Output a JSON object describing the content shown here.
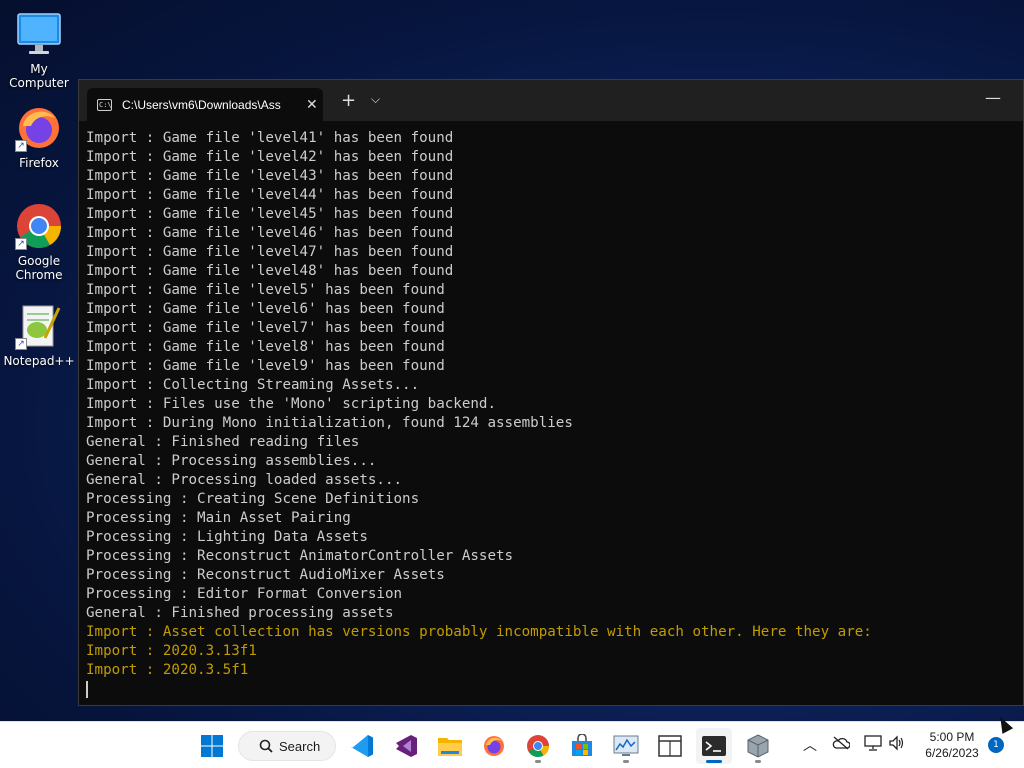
{
  "desktop": {
    "icons": [
      {
        "label": "My Computer",
        "icon": "monitor-icon"
      },
      {
        "label": "Firefox",
        "icon": "firefox-icon"
      },
      {
        "label": "Google Chrome",
        "icon": "chrome-icon"
      },
      {
        "label": "Notepad++",
        "icon": "notepadpp-icon"
      }
    ]
  },
  "terminal": {
    "tab_title": "C:\\Users\\vm6\\Downloads\\Ass",
    "close_glyph": "✕",
    "new_tab_glyph": "+",
    "dropdown_glyph": "⌵",
    "minimize_glyph": "—",
    "text_color": "#cccccc",
    "warn_color": "#c19c00",
    "lines": [
      {
        "text": "Import : Game file 'level41' has been found",
        "warn": false
      },
      {
        "text": "Import : Game file 'level42' has been found",
        "warn": false
      },
      {
        "text": "Import : Game file 'level43' has been found",
        "warn": false
      },
      {
        "text": "Import : Game file 'level44' has been found",
        "warn": false
      },
      {
        "text": "Import : Game file 'level45' has been found",
        "warn": false
      },
      {
        "text": "Import : Game file 'level46' has been found",
        "warn": false
      },
      {
        "text": "Import : Game file 'level47' has been found",
        "warn": false
      },
      {
        "text": "Import : Game file 'level48' has been found",
        "warn": false
      },
      {
        "text": "Import : Game file 'level5' has been found",
        "warn": false
      },
      {
        "text": "Import : Game file 'level6' has been found",
        "warn": false
      },
      {
        "text": "Import : Game file 'level7' has been found",
        "warn": false
      },
      {
        "text": "Import : Game file 'level8' has been found",
        "warn": false
      },
      {
        "text": "Import : Game file 'level9' has been found",
        "warn": false
      },
      {
        "text": "Import : Collecting Streaming Assets...",
        "warn": false
      },
      {
        "text": "Import : Files use the 'Mono' scripting backend.",
        "warn": false
      },
      {
        "text": "Import : During Mono initialization, found 124 assemblies",
        "warn": false
      },
      {
        "text": "General : Finished reading files",
        "warn": false
      },
      {
        "text": "General : Processing assemblies...",
        "warn": false
      },
      {
        "text": "General : Processing loaded assets...",
        "warn": false
      },
      {
        "text": "Processing : Creating Scene Definitions",
        "warn": false
      },
      {
        "text": "Processing : Main Asset Pairing",
        "warn": false
      },
      {
        "text": "Processing : Lighting Data Assets",
        "warn": false
      },
      {
        "text": "Processing : Reconstruct AnimatorController Assets",
        "warn": false
      },
      {
        "text": "Processing : Reconstruct AudioMixer Assets",
        "warn": false
      },
      {
        "text": "Processing : Editor Format Conversion",
        "warn": false
      },
      {
        "text": "General : Finished processing assets",
        "warn": false
      },
      {
        "text": "Import : Asset collection has versions probably incompatible with each other. Here they are:",
        "warn": true
      },
      {
        "text": "Import : 2020.3.13f1",
        "warn": true
      },
      {
        "text": "Import : 2020.3.5f1",
        "warn": true
      }
    ]
  },
  "taskbar": {
    "search_label": "Search",
    "apps": [
      {
        "name": "start-button",
        "icon": "windows-logo-icon",
        "running": false
      },
      {
        "name": "vscode-button",
        "icon": "vscode-icon",
        "running": false
      },
      {
        "name": "visual-studio-button",
        "icon": "visual-studio-icon",
        "running": false
      },
      {
        "name": "file-explorer-button",
        "icon": "folder-icon",
        "running": false
      },
      {
        "name": "firefox-button",
        "icon": "firefox-icon",
        "running": false
      },
      {
        "name": "chrome-button",
        "icon": "chrome-icon",
        "running": true
      },
      {
        "name": "store-button",
        "icon": "store-icon",
        "running": false
      },
      {
        "name": "resource-monitor-button",
        "icon": "monitor-chart-icon",
        "running": true
      },
      {
        "name": "taskview-button",
        "icon": "window-grid-icon",
        "running": false
      },
      {
        "name": "terminal-button",
        "icon": "terminal-icon",
        "running": true,
        "active": true
      },
      {
        "name": "asset-tool-button",
        "icon": "package-icon",
        "running": true
      }
    ],
    "time": "5:00 PM",
    "date": "6/26/2023",
    "notification_count": "1"
  }
}
